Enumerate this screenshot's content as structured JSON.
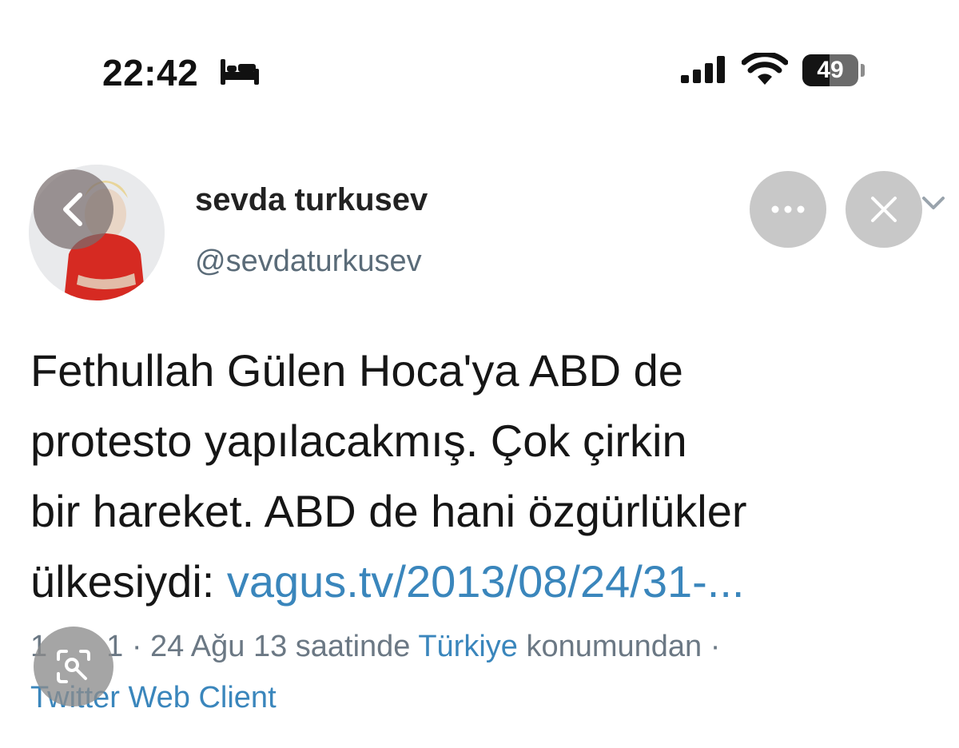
{
  "status_bar": {
    "time": "22:42",
    "battery": "49",
    "battery_level": 0.49,
    "icons": [
      "bed-icon",
      "signal-icon",
      "wifi-icon",
      "battery-icon"
    ]
  },
  "tweet": {
    "author_name": "sevda turkusev",
    "handle": "@sevdaturkusev",
    "text_lines": [
      "Fethullah Gülen Hoca'ya ABD de",
      "protesto yapılacakmış. Çok çirkin",
      "bir hareket. ABD de hani özgürlükler",
      "ülkesiydi: "
    ],
    "link_text": "vagus.tv/2013/08/24/31-...",
    "meta": {
      "time_partial": "1",
      "time_partial_2": "1",
      "date_text": " · 24 Ağu 13 saatinde ",
      "location": "Türkiye",
      "location_suffix": " konumundan ·",
      "client_partial": "Tw",
      "client_rest": "itter Web Client"
    }
  },
  "overlay": {
    "back_icon": "chevron-left-icon",
    "more_icon": "more-horizontal-icon",
    "close_icon": "close-icon",
    "lens_icon": "lens-search-icon"
  },
  "colors": {
    "link": "#3a86bc",
    "overlay_button": "#c8c8c8"
  }
}
